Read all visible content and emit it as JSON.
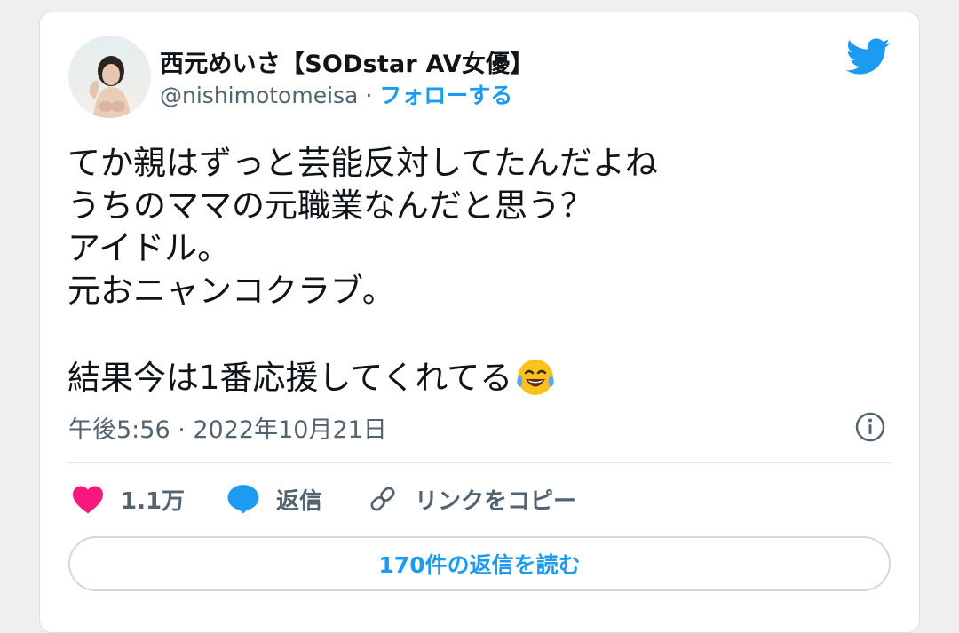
{
  "user": {
    "display_name": "西元めいさ【SODstar AV女優】",
    "handle": "@nishimotomeisa",
    "separator": "·",
    "follow_label": "フォローする"
  },
  "tweet": {
    "text": "てか親はずっと芸能反対してたんだよね\nうちのママの元職業なんだと思う？\nアイドル。\n元おニャンコクラブ。\n\n結果今は1番応援してくれてる",
    "emoji": "face-with-tears-of-joy",
    "timestamp": "午後5:56 · 2022年10月21日"
  },
  "actions": {
    "like_count": "1.1万",
    "reply_label": "返信",
    "copy_link_label": "リンクをコピー"
  },
  "read_replies_label": "170件の返信を読む",
  "colors": {
    "accent": "#1d9bf0",
    "like": "#f91880",
    "text": "#0f1419",
    "secondary": "#536471"
  },
  "icons": [
    "twitter-bird-icon",
    "info-icon",
    "heart-icon",
    "reply-bubble-icon",
    "link-icon"
  ]
}
